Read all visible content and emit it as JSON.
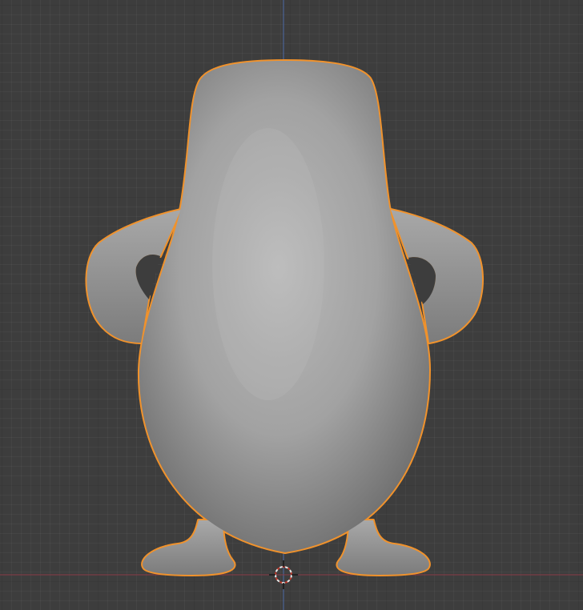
{
  "viewport": {
    "background_color": "#3d3d3d",
    "selection_outline_color": "#f0922c",
    "x_axis_color": "#8a3a46",
    "y_axis_color": "#4d6aa8",
    "mesh_color": "#a4a4a4",
    "selected_object": "sculpted-mesh"
  }
}
